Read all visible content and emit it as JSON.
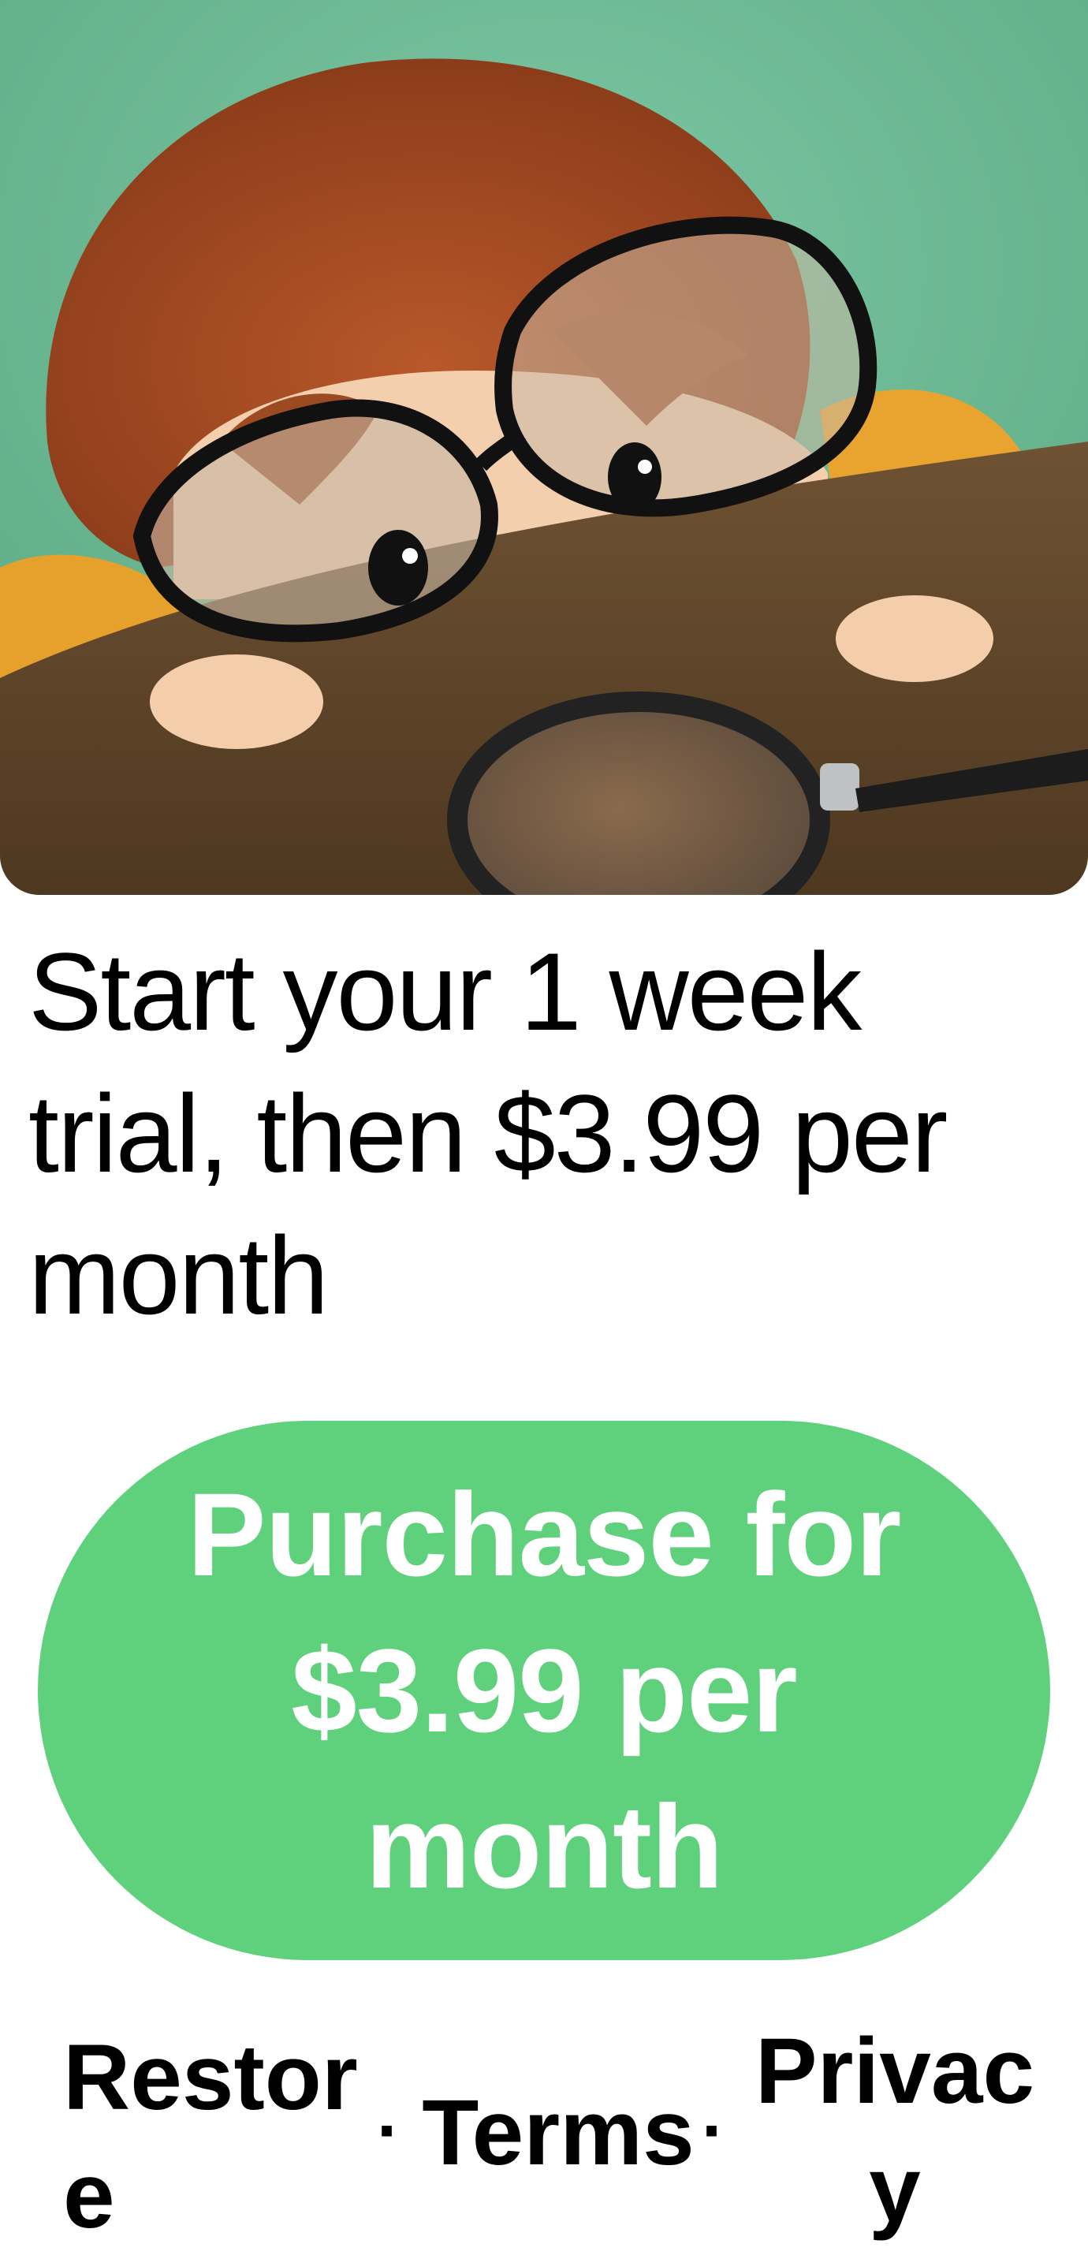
{
  "hero": {
    "image_name": "child-with-glasses-and-magnifying-glass-illustration"
  },
  "headline": {
    "text": "Start your 1 week trial, then $3.99 per month"
  },
  "purchase_button": {
    "label": "Purchase for $3.99 per month",
    "color": "#5fd07b"
  },
  "footer": {
    "restore_label": "Restore",
    "terms_label": "Terms",
    "privacy_label": "Privacy",
    "separator": "·"
  }
}
